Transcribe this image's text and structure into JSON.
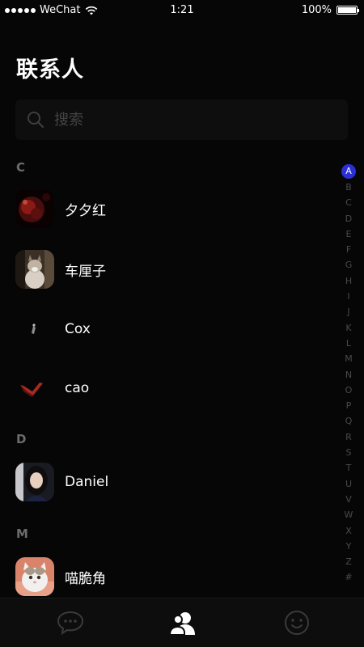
{
  "status_bar": {
    "carrier": "WeChat",
    "time": "1:21",
    "battery": "100%",
    "battery_level": 1.0
  },
  "page": {
    "title": "联系人"
  },
  "search": {
    "placeholder": "搜索",
    "icon": "search-icon"
  },
  "sections": [
    {
      "letter": "C",
      "contacts": [
        "夕夕红",
        "车厘子",
        "Cox",
        "cao"
      ]
    },
    {
      "letter": "D",
      "contacts": [
        "Daniel"
      ]
    },
    {
      "letter": "M",
      "contacts": [
        "喵脆角"
      ]
    }
  ],
  "index": {
    "active": "A",
    "letters": [
      "A",
      "B",
      "C",
      "D",
      "E",
      "F",
      "G",
      "H",
      "I",
      "J",
      "K",
      "L",
      "M",
      "N",
      "O",
      "P",
      "Q",
      "R",
      "S",
      "T",
      "U",
      "V",
      "W",
      "X",
      "Y",
      "Z",
      "#"
    ]
  },
  "tab_bar": {
    "tabs": [
      {
        "icon": "chat-bubble-icon",
        "active": false
      },
      {
        "icon": "contacts-icon",
        "active": true
      },
      {
        "icon": "smiley-icon",
        "active": false
      }
    ]
  },
  "colors": {
    "background": "#060606",
    "index_active": "#2b2fd6",
    "section_header": "#6b6b6b"
  }
}
